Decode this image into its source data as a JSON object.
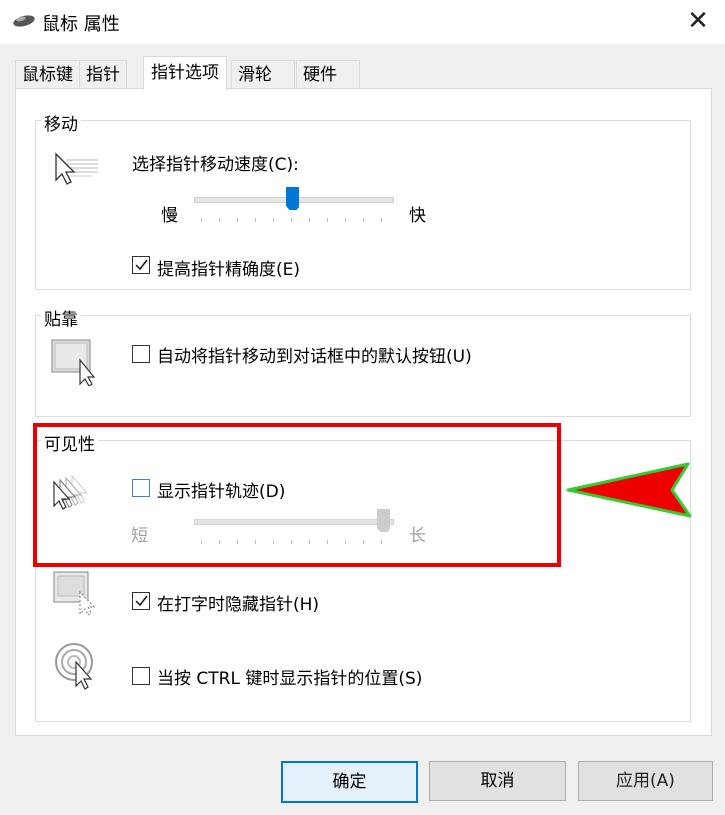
{
  "window": {
    "title": "鼠标 属性",
    "close_glyph": "✕"
  },
  "tabs": [
    {
      "label": "鼠标键"
    },
    {
      "label": "指针"
    },
    {
      "label": "指针选项",
      "active": true
    },
    {
      "label": "滑轮"
    },
    {
      "label": "硬件"
    }
  ],
  "motion": {
    "group_label": "移动",
    "speed_label": "选择指针移动速度(C):",
    "slow": "慢",
    "fast": "快",
    "speed_level": 0.5,
    "precision_label": "提高指针精确度(E)",
    "precision_checked": true
  },
  "snap": {
    "group_label": "贴靠",
    "snap_label": "自动将指针移动到对话框中的默认按钮(U)",
    "snap_checked": false
  },
  "visibility": {
    "group_label": "可见性",
    "trails_label": "显示指针轨迹(D)",
    "trails_checked": false,
    "short": "短",
    "long": "长",
    "trail_level": 1.0,
    "hide_label": "在打字时隐藏指针(H)",
    "hide_checked": true,
    "ctrl_label": "当按 CTRL 键时显示指针的位置(S)",
    "ctrl_checked": false
  },
  "buttons": {
    "ok": "确定",
    "cancel": "取消",
    "apply": "应用(A)"
  },
  "annotation": {
    "box_color": "#e00000",
    "arrow_color": "#ee0000",
    "arrow_outline": "#33cc33"
  },
  "colors": {
    "accent": "#0078d7"
  }
}
